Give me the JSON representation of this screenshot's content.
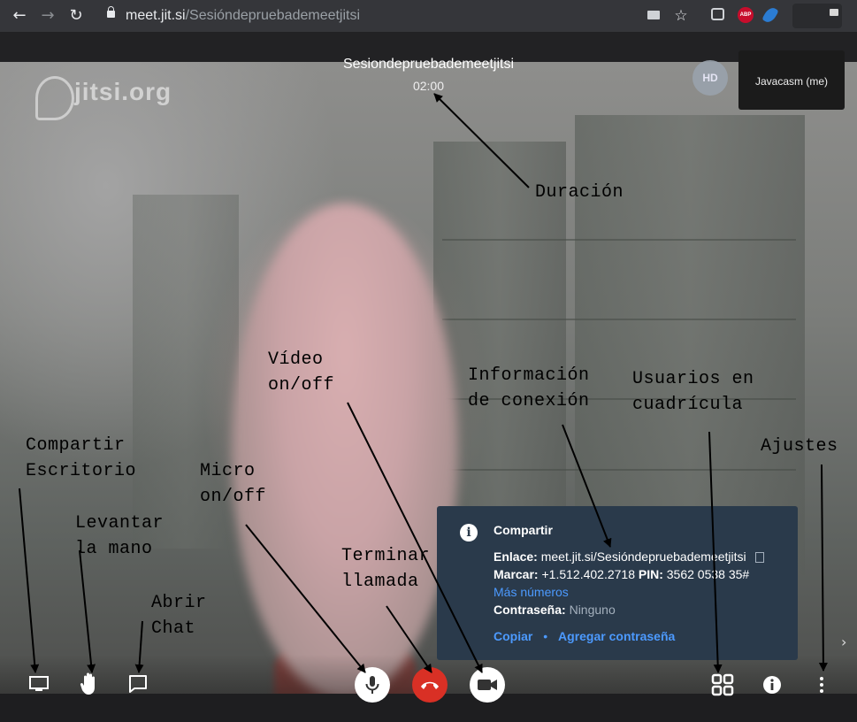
{
  "browser": {
    "url_host": "meet.jit.si",
    "url_path": "/Sesióndepruebademeetjitsi",
    "back_icon": "←",
    "forward_icon": "→",
    "reload_icon": "↻",
    "star_icon": "☆",
    "camera_icon": "■",
    "abp_label": "ABP"
  },
  "meeting": {
    "logo_text": "jitsi.org",
    "title": "Sesiondepruebademeetjitsi",
    "timer": "02:00",
    "hd_label": "HD",
    "participant_name": "Javacasm (me)"
  },
  "info_popup": {
    "heading": "Compartir",
    "link_label": "Enlace:",
    "link_value": "meet.jit.si/Sesióndepruebademeetjitsi",
    "dial_label": "Marcar:",
    "dial_value": "+1.512.402.2718",
    "pin_label": "PIN:",
    "pin_value": "3562 0538 35#",
    "more_numbers": "Más números",
    "password_label": "Contraseña:",
    "password_value": "Ninguno",
    "copy_label": "Copiar",
    "separator": "•",
    "add_password_label": "Agregar contraseña"
  },
  "annotations": {
    "duracion": "Duración",
    "video": "Vídeo\non/off",
    "informacion": "Información\nde conexión",
    "usuarios": "Usuarios en\ncuadrícula",
    "compartir": "Compartir\nEscritorio",
    "micro": "Micro\non/off",
    "ajustes": "Ajustes",
    "levantar": "Levantar\nla mano",
    "terminar": "Terminar\nllamada",
    "abrir_chat": "Abrir\nChat"
  },
  "colors": {
    "hangup": "#d93025",
    "popup_bg": "#2a3a4b",
    "link": "#4c9aff"
  }
}
